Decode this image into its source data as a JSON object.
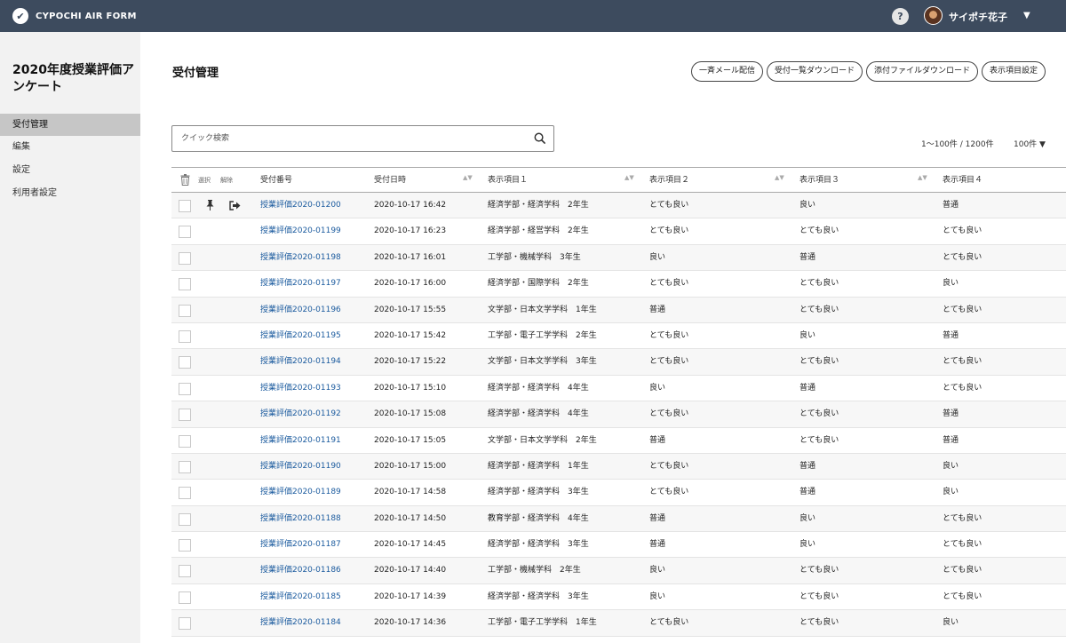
{
  "app": {
    "name": "CYPOCHI AIR FORM",
    "logo_glyph": "✔"
  },
  "header": {
    "help_label": "?",
    "user_name": "サイポチ花子",
    "caret": "▼"
  },
  "sidebar": {
    "survey_title": "2020年度授業評価アンケート",
    "items": [
      {
        "label": "受付管理",
        "active": true
      },
      {
        "label": "編集"
      },
      {
        "label": "設定"
      },
      {
        "label": "利用者設定"
      }
    ]
  },
  "main": {
    "title": "受付管理",
    "actions": [
      "一斉メール配信",
      "受付一覧ダウンロード",
      "添付ファイルダウンロード",
      "表示項目設定"
    ],
    "search_placeholder": "クイック検索",
    "count": "1～100件 / 1200件",
    "per_page": "100件 ▼"
  },
  "table": {
    "select_label": "選択",
    "clear_label": "解除",
    "sort_glyph": "▲▼",
    "headers": [
      "受付番号",
      "受付日時",
      "表示項目１",
      "表示項目２",
      "表示項目３",
      "表示項目４"
    ],
    "rows": [
      {
        "id": "授業評価2020-01200",
        "date": "2020-10-17 16:42",
        "item1": "経済学部・経済学科　2年生",
        "item2": "とても良い",
        "item3": "良い",
        "item4": "普通",
        "pinned": true
      },
      {
        "id": "授業評価2020-01199",
        "date": "2020-10-17 16:23",
        "item1": "経済学部・経営学科　2年生",
        "item2": "とても良い",
        "item3": "とても良い",
        "item4": "とても良い"
      },
      {
        "id": "授業評価2020-01198",
        "date": "2020-10-17 16:01",
        "item1": "工学部・機械学科　3年生",
        "item2": "良い",
        "item3": "普通",
        "item4": "とても良い"
      },
      {
        "id": "授業評価2020-01197",
        "date": "2020-10-17 16:00",
        "item1": "経済学部・国際学科　2年生",
        "item2": "とても良い",
        "item3": "とても良い",
        "item4": "良い"
      },
      {
        "id": "授業評価2020-01196",
        "date": "2020-10-17 15:55",
        "item1": "文学部・日本文学学科　1年生",
        "item2": "普通",
        "item3": "とても良い",
        "item4": "とても良い"
      },
      {
        "id": "授業評価2020-01195",
        "date": "2020-10-17 15:42",
        "item1": "工学部・電子工学学科　2年生",
        "item2": "とても良い",
        "item3": "良い",
        "item4": "普通"
      },
      {
        "id": "授業評価2020-01194",
        "date": "2020-10-17 15:22",
        "item1": "文学部・日本文学学科　3年生",
        "item2": "とても良い",
        "item3": "とても良い",
        "item4": "とても良い"
      },
      {
        "id": "授業評価2020-01193",
        "date": "2020-10-17 15:10",
        "item1": "経済学部・経済学科　4年生",
        "item2": "良い",
        "item3": "普通",
        "item4": "とても良い"
      },
      {
        "id": "授業評価2020-01192",
        "date": "2020-10-17 15:08",
        "item1": "経済学部・経済学科　4年生",
        "item2": "とても良い",
        "item3": "とても良い",
        "item4": "普通"
      },
      {
        "id": "授業評価2020-01191",
        "date": "2020-10-17 15:05",
        "item1": "文学部・日本文学学科　2年生",
        "item2": "普通",
        "item3": "とても良い",
        "item4": "普通"
      },
      {
        "id": "授業評価2020-01190",
        "date": "2020-10-17 15:00",
        "item1": "経済学部・経済学科　1年生",
        "item2": "とても良い",
        "item3": "普通",
        "item4": "良い"
      },
      {
        "id": "授業評価2020-01189",
        "date": "2020-10-17 14:58",
        "item1": "経済学部・経済学科　3年生",
        "item2": "とても良い",
        "item3": "普通",
        "item4": "良い"
      },
      {
        "id": "授業評価2020-01188",
        "date": "2020-10-17 14:50",
        "item1": "教育学部・経済学科　4年生",
        "item2": "普通",
        "item3": "良い",
        "item4": "とても良い"
      },
      {
        "id": "授業評価2020-01187",
        "date": "2020-10-17 14:45",
        "item1": "経済学部・経済学科　3年生",
        "item2": "普通",
        "item3": "良い",
        "item4": "とても良い"
      },
      {
        "id": "授業評価2020-01186",
        "date": "2020-10-17 14:40",
        "item1": "工学部・機械学科　2年生",
        "item2": "良い",
        "item3": "とても良い",
        "item4": "とても良い"
      },
      {
        "id": "授業評価2020-01185",
        "date": "2020-10-17 14:39",
        "item1": "経済学部・経済学科　3年生",
        "item2": "良い",
        "item3": "とても良い",
        "item4": "とても良い"
      },
      {
        "id": "授業評価2020-01184",
        "date": "2020-10-17 14:36",
        "item1": "工学部・電子工学学科　1年生",
        "item2": "とても良い",
        "item3": "とても良い",
        "item4": "良い"
      }
    ]
  },
  "colors": {
    "topbar": "#3d4b5e",
    "link": "#1a5a9e",
    "sidebar_bg": "#f2f2f2",
    "sidebar_active": "#c6c6c6"
  }
}
